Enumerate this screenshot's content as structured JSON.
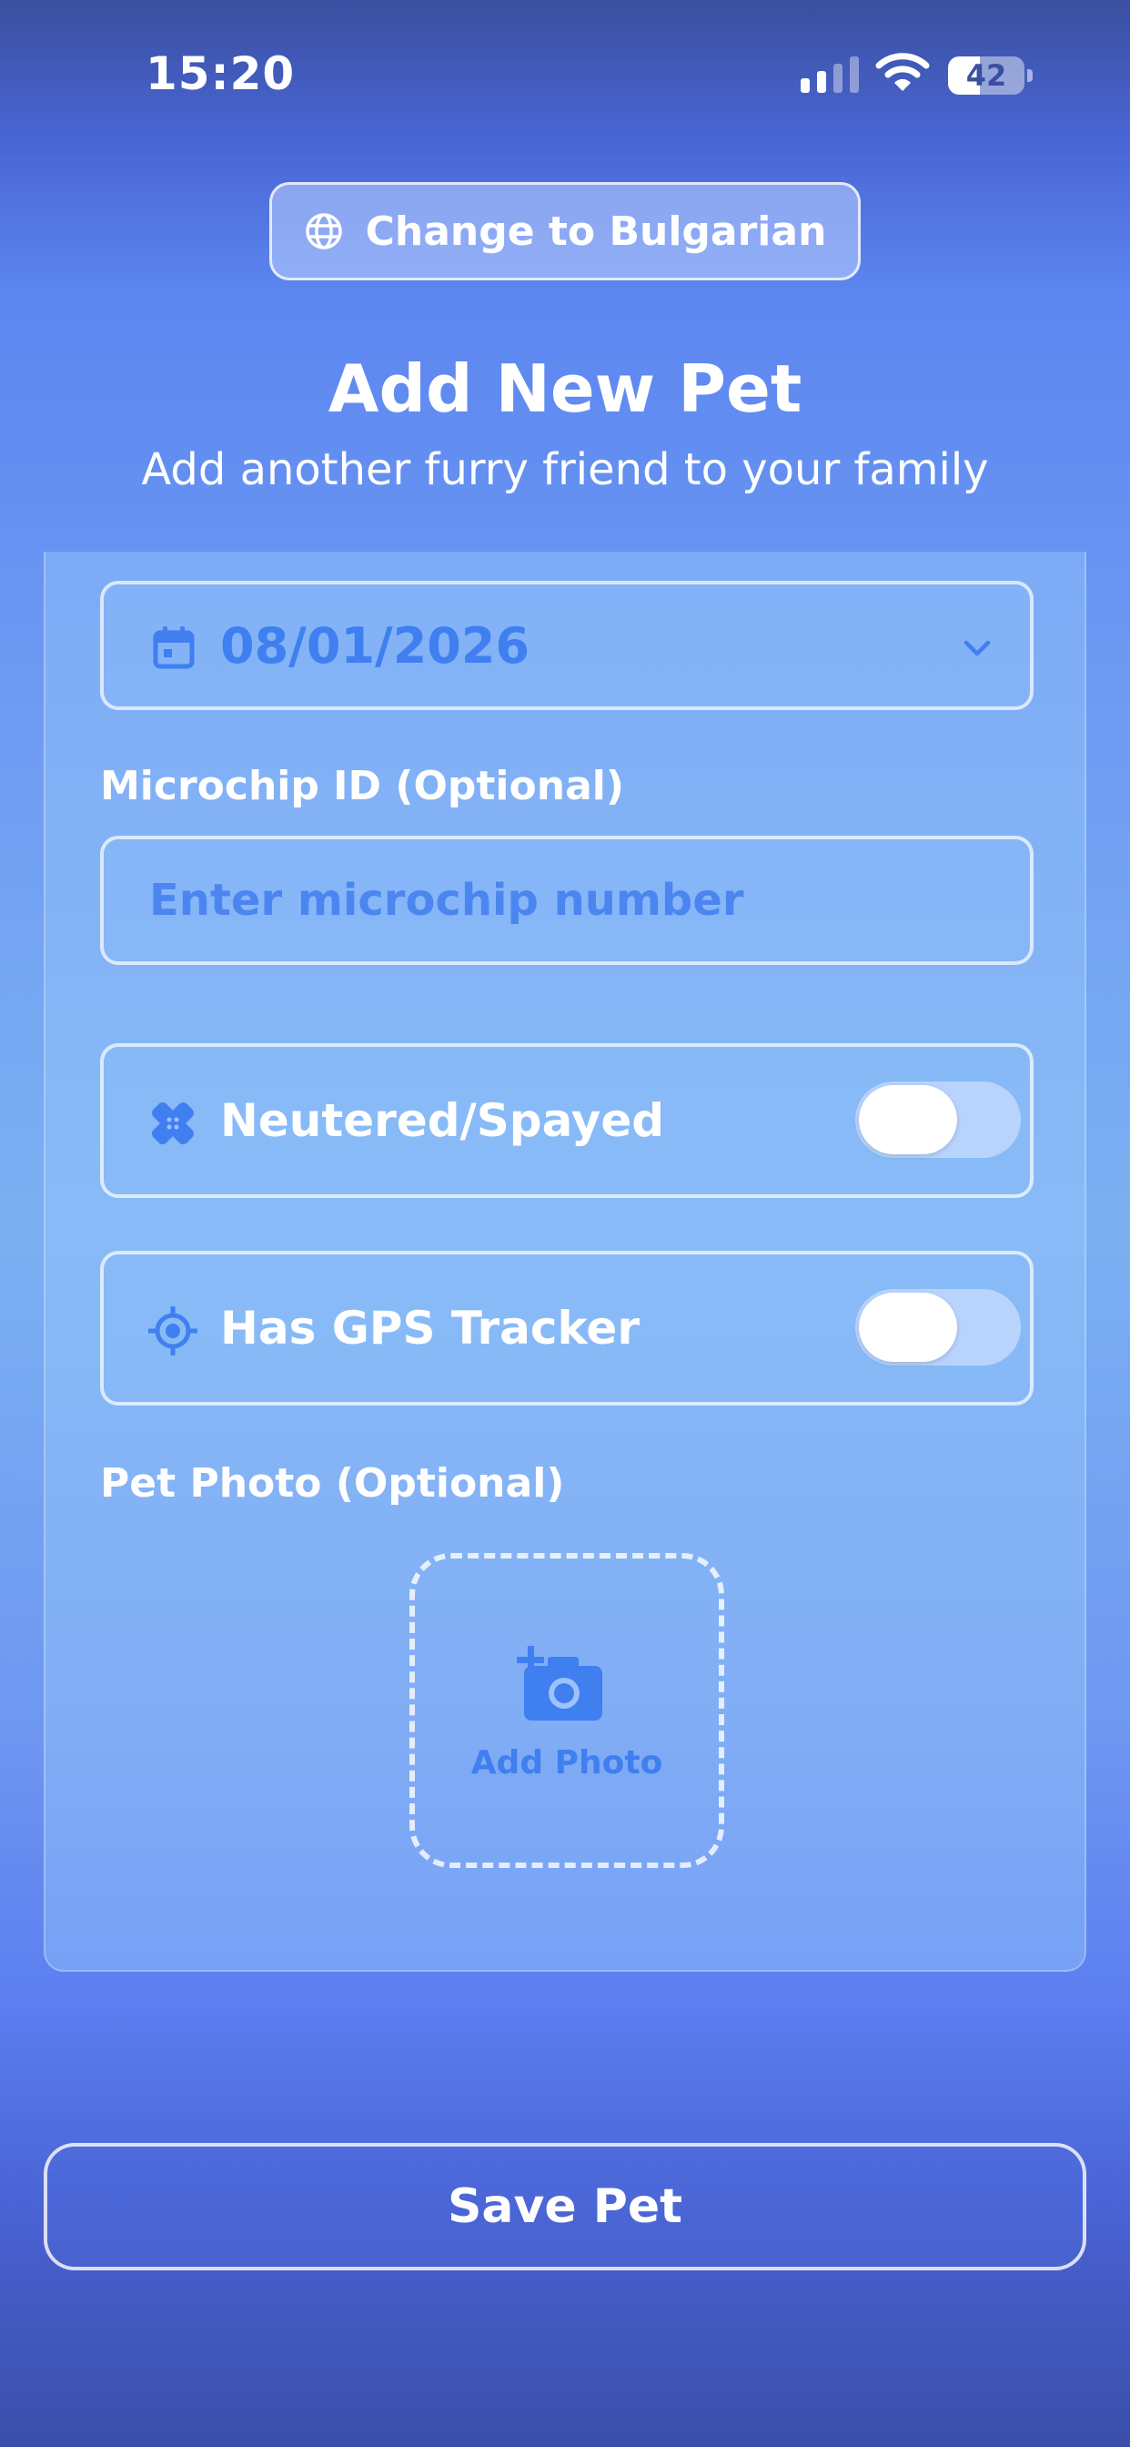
{
  "status_bar": {
    "time": "15:20",
    "battery_level": "42",
    "battery_fraction": 0.42
  },
  "language_button": {
    "label": "Change to Bulgarian",
    "icon": "globe-icon"
  },
  "header": {
    "title": "Add New Pet",
    "subtitle": "Add another furry friend to your family"
  },
  "form": {
    "date_value": "08/01/2026",
    "microchip": {
      "label": "Microchip ID (Optional)",
      "placeholder": "Enter microchip number",
      "value": ""
    },
    "neutered": {
      "label": "Neutered/Spayed",
      "enabled": false,
      "icon": "bandage-icon"
    },
    "gps": {
      "label": "Has GPS Tracker",
      "enabled": false,
      "icon": "gps-target-icon"
    },
    "photo": {
      "label": "Pet Photo (Optional)",
      "button_label": "Add Photo",
      "icon": "add-camera-icon"
    }
  },
  "save_button": {
    "label": "Save Pet"
  },
  "colors": {
    "accent_blue": "#3f7ff0",
    "text_white": "#ffffff"
  }
}
